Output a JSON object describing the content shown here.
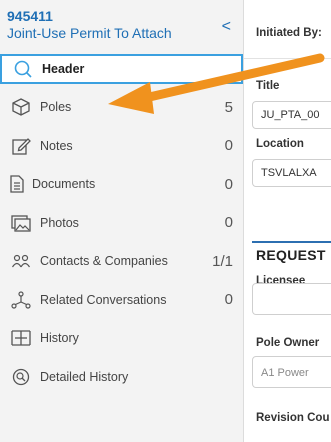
{
  "record": {
    "id": "945411",
    "type": "Joint-Use Permit To Attach",
    "collapse_glyph": "<"
  },
  "nav": [
    {
      "name": "nav-item-header",
      "label": "Header",
      "count": "",
      "icon": "search-icon",
      "active": true
    },
    {
      "name": "nav-item-poles",
      "label": "Poles",
      "count": "5",
      "icon": "box-icon"
    },
    {
      "name": "nav-item-notes",
      "label": "Notes",
      "count": "0",
      "icon": "edit-note-icon"
    },
    {
      "name": "nav-item-documents",
      "label": "Documents",
      "count": "0",
      "icon": "document-icon"
    },
    {
      "name": "nav-item-photos",
      "label": "Photos",
      "count": "0",
      "icon": "photo-icon"
    },
    {
      "name": "nav-item-contacts",
      "label": "Contacts & Companies",
      "count": "1/1",
      "icon": "contacts-icon"
    },
    {
      "name": "nav-item-related-conversations",
      "label": "Related Conversations",
      "count": "0",
      "icon": "network-icon"
    },
    {
      "name": "nav-item-history",
      "label": "History",
      "count": "",
      "icon": "history-icon"
    },
    {
      "name": "nav-item-detailed-history",
      "label": "Detailed History",
      "count": "",
      "icon": "detailed-history-icon"
    }
  ],
  "main": {
    "initiated_by_label": "Initiated By:",
    "title_label": "Title",
    "title_value": "JU_PTA_00",
    "location_label": "Location",
    "location_value": "TSVLALXA",
    "section_title": "REQUEST",
    "licensee_label": "Licensee",
    "licensee_value": "",
    "pole_owner_label": "Pole Owner",
    "pole_owner_value": "A1 Power",
    "revision_label": "Revision Cou"
  },
  "colors": {
    "accent": "#1f6fb5",
    "active_border": "#3aa0e0",
    "annotation_arrow": "#f0921e"
  }
}
